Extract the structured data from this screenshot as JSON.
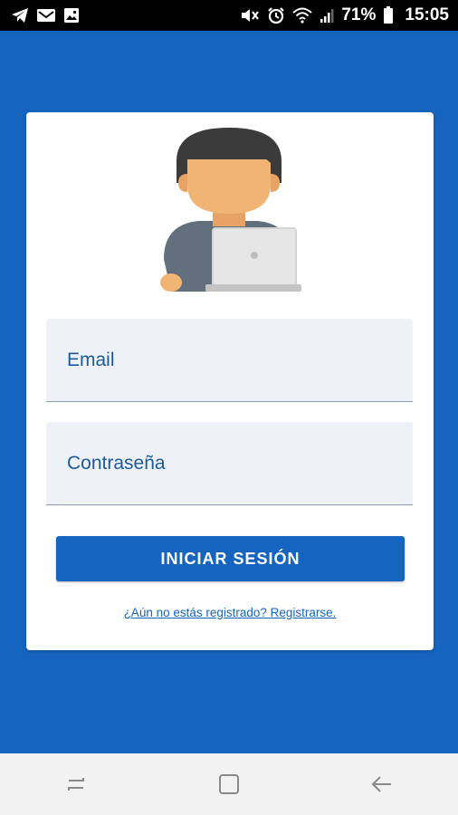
{
  "status_bar": {
    "battery_percent": "71%",
    "time": "15:05",
    "icons": [
      "telegram-icon",
      "gmail-icon",
      "image-icon",
      "mute-icon",
      "alarm-icon",
      "wifi-icon",
      "signal-icon",
      "battery-icon"
    ]
  },
  "login": {
    "avatar_icon": "user-laptop-icon",
    "email_placeholder": "Email",
    "password_placeholder": "Contraseña",
    "login_button": "INICIAR SESIÓN",
    "register_link": "¿Aún no estás registrado? Registrarse."
  },
  "nav_bar": {
    "icons": [
      "recent-apps-icon",
      "home-icon",
      "back-icon"
    ]
  },
  "colors": {
    "primary": "#1565c0",
    "field_bg": "#eef2f8",
    "status_bar": "#000000",
    "nav_bar": "#f2f2f2"
  }
}
